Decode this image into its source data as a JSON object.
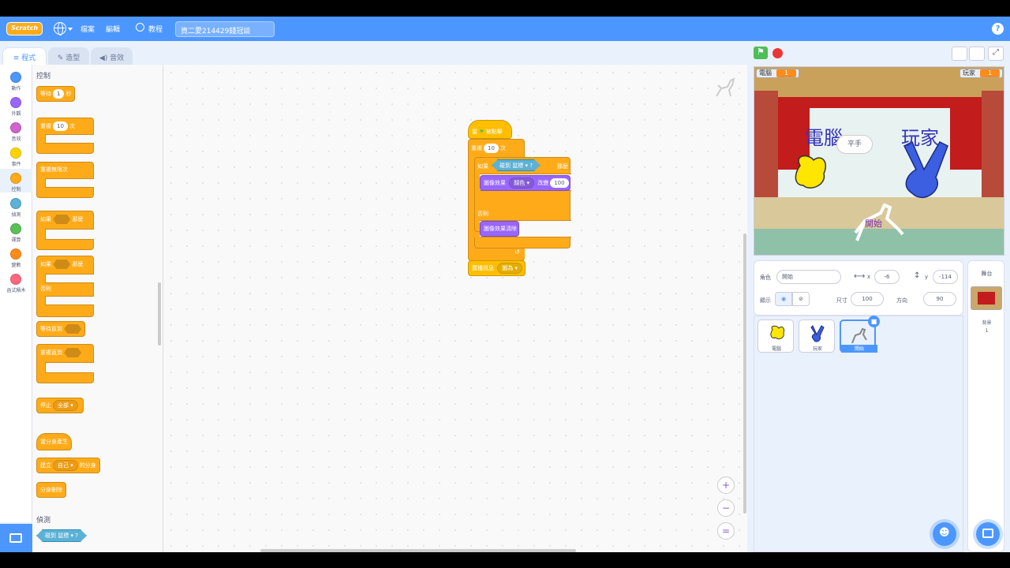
{
  "menubar": {
    "logo": "Scratch",
    "file": "檔案",
    "edit": "編輯",
    "tutorials": "教程",
    "project_title": "資二愛214429錢冠談",
    "help": "?"
  },
  "tabs": {
    "code": "程式",
    "costumes": "造型",
    "sounds": "音效"
  },
  "categories": [
    {
      "label": "動作",
      "color": "#4c97ff"
    },
    {
      "label": "外觀",
      "color": "#9966ff"
    },
    {
      "label": "音效",
      "color": "#cf63cf"
    },
    {
      "label": "事件",
      "color": "#ffd500"
    },
    {
      "label": "控制",
      "color": "#ffab19"
    },
    {
      "label": "偵測",
      "color": "#5cb1d6"
    },
    {
      "label": "運算",
      "color": "#59c059"
    },
    {
      "label": "變數",
      "color": "#ff8c1a"
    },
    {
      "label": "函式積木",
      "color": "#ff6680"
    }
  ],
  "palette": {
    "control_heading": "控制",
    "wait": "等待",
    "wait_val": "1",
    "wait_unit": "秒",
    "repeat": "重複",
    "repeat_val": "10",
    "repeat_unit": "次",
    "forever": "重複無限次",
    "if": "如果",
    "then": "那麼",
    "if2": "如果",
    "then2": "那麼",
    "else": "否則",
    "wait_until": "等待直到",
    "repeat_until": "重複直到",
    "stop": "停止",
    "stop_val": "全部",
    "when_clone": "當分身產生",
    "create_clone": "建立",
    "create_clone_val": "自己",
    "create_clone_suffix": "的分身",
    "delete_clone": "分身刪除",
    "sensing_heading": "偵測",
    "touching": "碰到",
    "touching_val": "鼠標",
    "touching_q": "?"
  },
  "script": {
    "hat": "當",
    "hat_suffix": "被點擊",
    "repeat": "重複",
    "repeat_val": "10",
    "repeat_unit": "次",
    "if": "如果",
    "touching": "碰到",
    "touching_val": "鼠標",
    "q": "?",
    "then": "那麼",
    "effect": "圖像效果",
    "effect_val": "顏色",
    "change_by": "改變",
    "change_val": "100",
    "else": "否則",
    "clear": "圖像效果清除",
    "broadcast": "廣播訊息",
    "broadcast_val": "圖為"
  },
  "stage": {
    "monitor1_label": "電腦",
    "monitor1_val": "1",
    "monitor2_label": "玩家",
    "monitor2_val": "1",
    "text_left": "電腦",
    "text_right": "玩家",
    "bubble": "平手",
    "start": "開始"
  },
  "sprite_info": {
    "sprite_label": "角色",
    "sprite_name": "開始",
    "x_label": "x",
    "x_val": "-6",
    "y_label": "y",
    "y_val": "-114",
    "show_label": "顯示",
    "size_label": "尺寸",
    "size_val": "100",
    "dir_label": "方向",
    "dir_val": "90"
  },
  "sprites": [
    {
      "name": "電腦"
    },
    {
      "name": "玩家"
    },
    {
      "name": "開始"
    }
  ],
  "stage_panel": {
    "title": "舞台",
    "backdrops_label": "背景",
    "backdrops_count": "1"
  }
}
